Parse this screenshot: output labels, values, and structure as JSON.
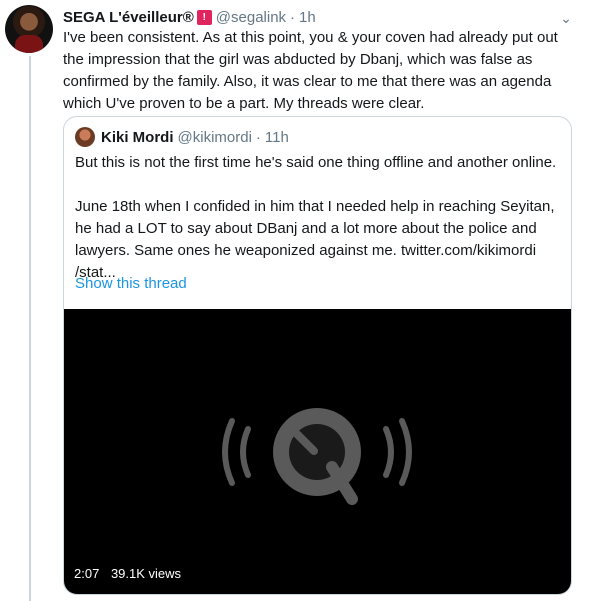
{
  "tweet": {
    "display_name": "SEGA L'éveilleur®",
    "badge": "🚨",
    "handle": "@segalink",
    "separator": "·",
    "time": "1h",
    "text": "I've been consistent. As at this point, you & your coven had already put out the impression that the girl was abducted by Dbanj, which was false as confirmed by the family. Also, it was clear to me that there was an agenda which U've proven to be a part. My threads were clear."
  },
  "quote": {
    "display_name": "Kiki Mordi",
    "handle": "@kikimordi",
    "separator": "·",
    "time": "11h",
    "paragraph1": "But this is not the first time he's said one thing offline and another online.",
    "paragraph2": "June 18th when I confided in him that I needed help in reaching Seyitan, he had a LOT to say about DBanj and a lot more about the police and lawyers. Same ones he weaponized against me.  twitter.com/kikimordi /stat...",
    "show_thread": "Show this thread",
    "video": {
      "duration": "2:07",
      "views": "39.1K views",
      "icon": "quicktime-logo-icon"
    }
  },
  "colors": {
    "link": "#1b95e0",
    "muted": "#657786",
    "border": "#ccd6dd",
    "text": "#14171a"
  }
}
